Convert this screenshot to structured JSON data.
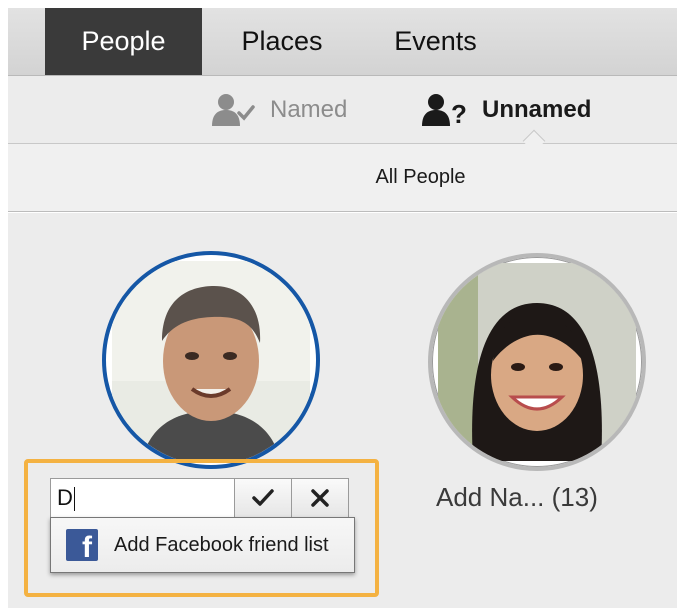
{
  "tabs": [
    {
      "label": "People",
      "active": true
    },
    {
      "label": "Places",
      "active": false
    },
    {
      "label": "Events",
      "active": false
    }
  ],
  "filters": {
    "named": {
      "label": "Named",
      "icon": "person-check-icon",
      "active": false
    },
    "unnamed": {
      "label": "Unnamed",
      "icon": "person-question-icon",
      "active": true
    }
  },
  "all_people_label": "All People",
  "faces": [
    {
      "icon": "face-photo-man",
      "selected": true
    },
    {
      "icon": "face-photo-woman",
      "label": "Add Na... (13)"
    }
  ],
  "name_editor": {
    "value": "D",
    "confirm_icon": "checkmark-icon",
    "cancel_icon": "close-icon",
    "suggestion": {
      "icon": "facebook-icon",
      "label": "Add Facebook friend list"
    }
  },
  "colors": {
    "selection_ring": "#1557a6",
    "highlight": "#f4b242",
    "active_tab": "#3a3a3a",
    "facebook": "#3b5998"
  }
}
